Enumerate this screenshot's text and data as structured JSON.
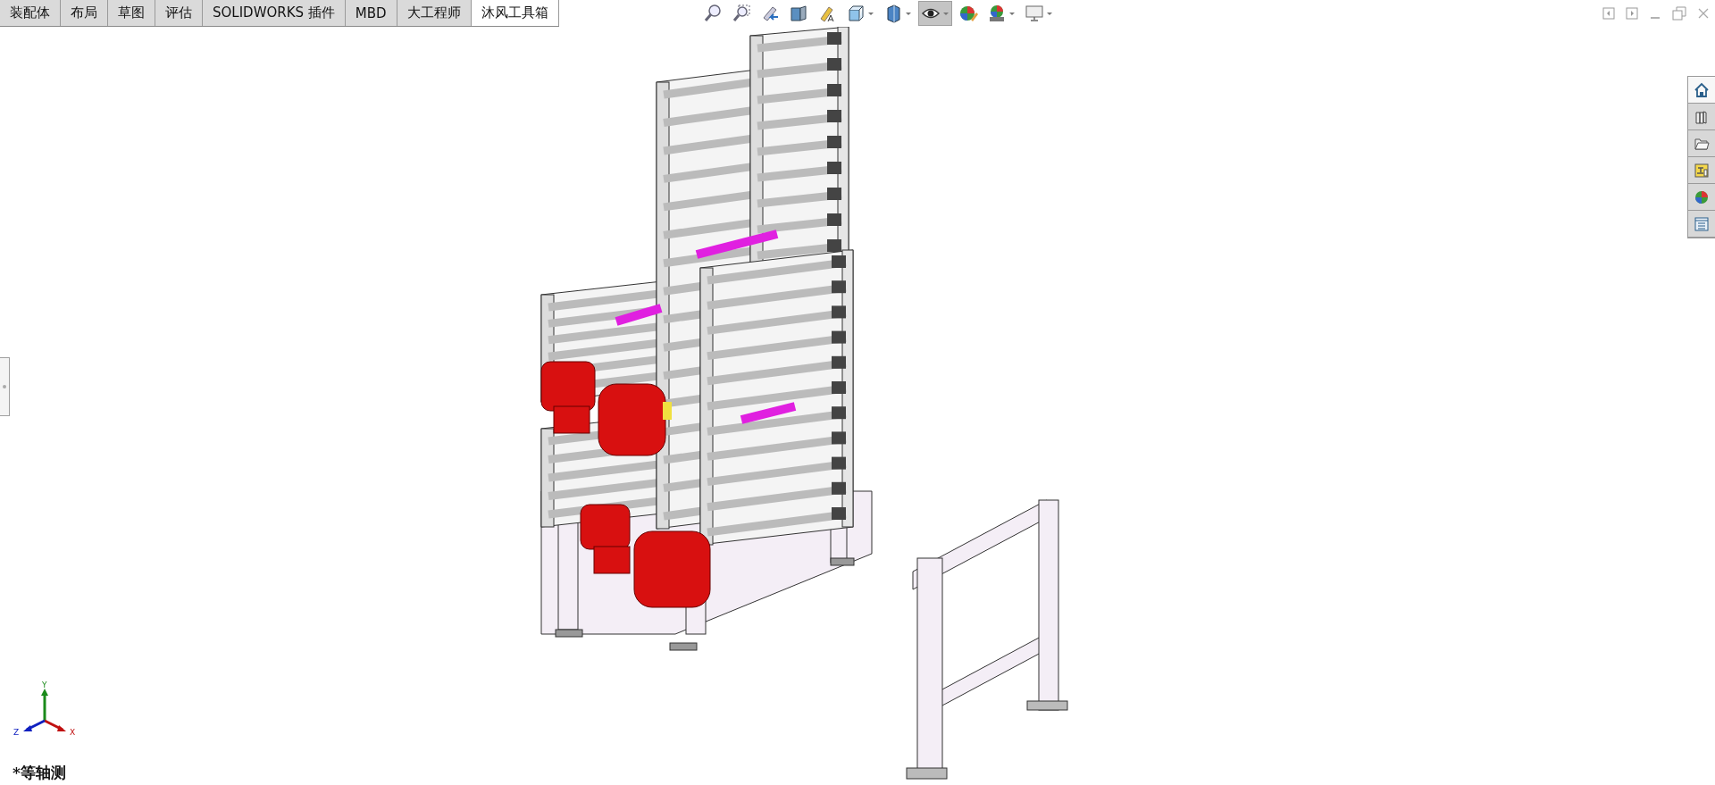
{
  "tabs": [
    {
      "label": "装配体",
      "selected": false
    },
    {
      "label": "布局",
      "selected": false
    },
    {
      "label": "草图",
      "selected": false
    },
    {
      "label": "评估",
      "selected": false
    },
    {
      "label": "SOLIDWORKS 插件",
      "selected": false
    },
    {
      "label": "MBD",
      "selected": false
    },
    {
      "label": "大工程师",
      "selected": false
    },
    {
      "label": "沐风工具箱",
      "selected": true
    }
  ],
  "view_toolbar": [
    {
      "kind": "zoom-fit",
      "selected": false,
      "dropdown": false
    },
    {
      "kind": "zoom-area",
      "selected": false,
      "dropdown": false
    },
    {
      "kind": "previous-view",
      "selected": false,
      "dropdown": false
    },
    {
      "kind": "section",
      "selected": false,
      "dropdown": false
    },
    {
      "kind": "annotation",
      "selected": false,
      "dropdown": false
    },
    {
      "kind": "orientation",
      "selected": false,
      "dropdown": true
    },
    {
      "kind": "display-style",
      "selected": false,
      "dropdown": true
    },
    {
      "kind": "hide-show",
      "selected": true,
      "dropdown": true
    },
    {
      "kind": "appearance",
      "selected": false,
      "dropdown": false
    },
    {
      "kind": "scene",
      "selected": false,
      "dropdown": true
    },
    {
      "kind": "monitor",
      "selected": false,
      "dropdown": true
    }
  ],
  "task_pane": [
    {
      "kind": "home",
      "selected": true
    },
    {
      "kind": "library",
      "selected": false
    },
    {
      "kind": "folder",
      "selected": false
    },
    {
      "kind": "palette",
      "selected": false
    },
    {
      "kind": "appearance",
      "selected": false
    },
    {
      "kind": "properties",
      "selected": false
    }
  ],
  "triad": {
    "x": "X",
    "y": "Y",
    "z": "Z"
  },
  "view_label": "*等轴测"
}
